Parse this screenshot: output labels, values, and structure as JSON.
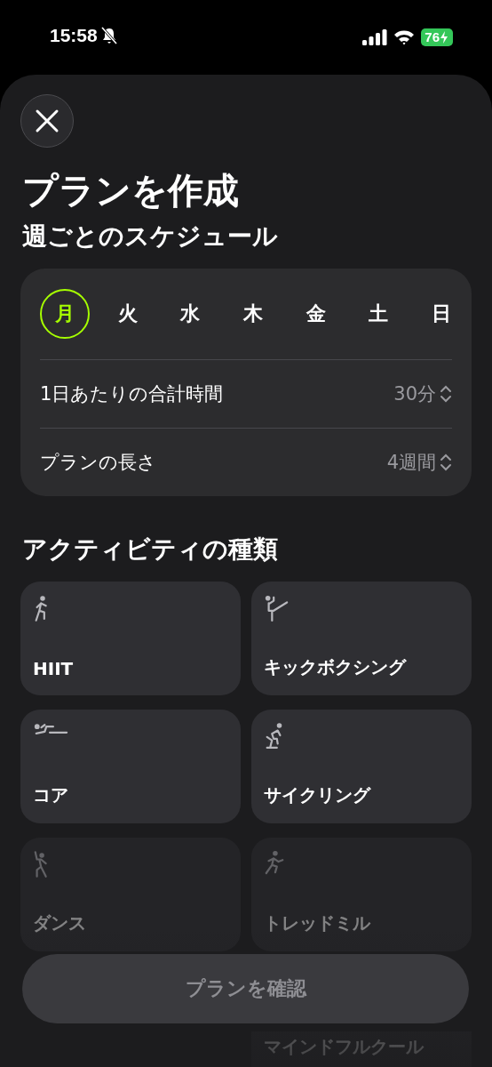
{
  "status_bar": {
    "time": "15:58",
    "silent": true,
    "battery": "76",
    "charging": true
  },
  "title": "プランを作成",
  "schedule": {
    "heading": "週ごとのスケジュール",
    "days": [
      {
        "label": "月",
        "selected": true
      },
      {
        "label": "火",
        "selected": false
      },
      {
        "label": "水",
        "selected": false
      },
      {
        "label": "木",
        "selected": false
      },
      {
        "label": "金",
        "selected": false
      },
      {
        "label": "土",
        "selected": false
      },
      {
        "label": "日",
        "selected": false
      }
    ],
    "settings": [
      {
        "label": "1日あたりの合計時間",
        "value": "30分"
      },
      {
        "label": "プランの長さ",
        "value": "4週間"
      }
    ]
  },
  "activities": {
    "heading": "アクティビティの種類",
    "items": [
      {
        "kind": "hiit",
        "label": "HIIT"
      },
      {
        "kind": "kickboxing",
        "label": "キックボクシング"
      },
      {
        "kind": "core",
        "label": "コア"
      },
      {
        "kind": "cycling",
        "label": "サイクリング"
      },
      {
        "kind": "dance",
        "label": "ダンス"
      },
      {
        "kind": "treadmill",
        "label": "トレッドミル"
      },
      {
        "kind": "mindful",
        "label": "マインドフルクール"
      }
    ]
  },
  "confirm_button": {
    "label": "プランを確認",
    "disabled": true
  }
}
